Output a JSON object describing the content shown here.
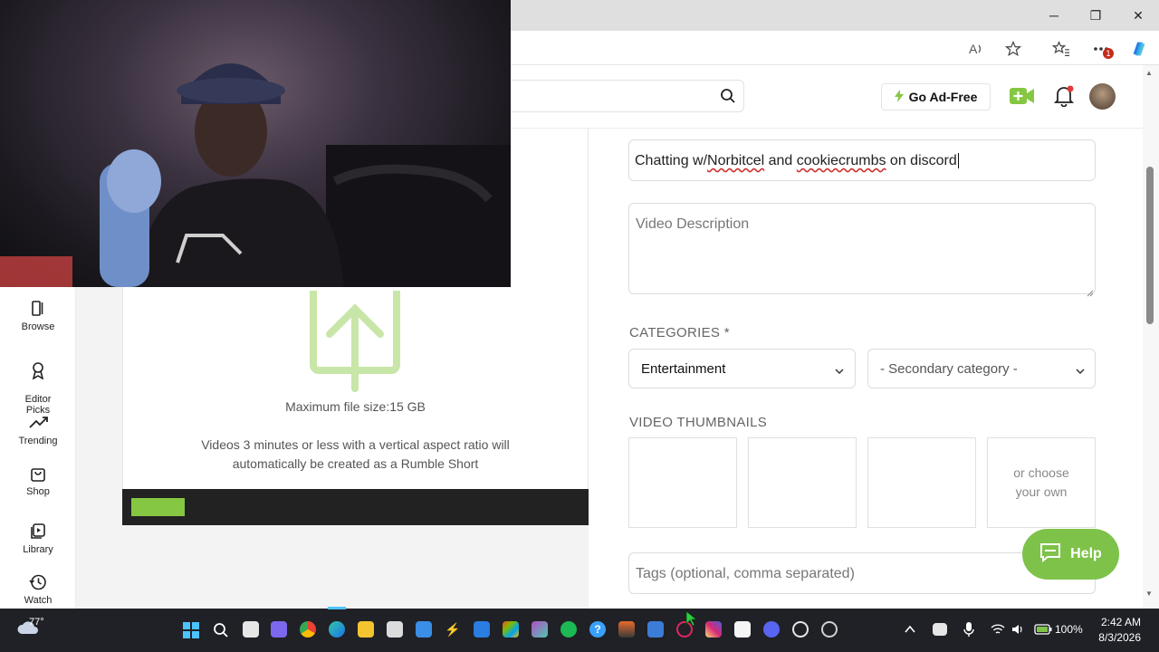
{
  "browser": {
    "window_controls": [
      "─",
      "❐",
      "✕"
    ],
    "notification_count": "1"
  },
  "header": {
    "go_adfree_label": "Go Ad-Free"
  },
  "sidebar": {
    "items": [
      {
        "label": "Browse"
      },
      {
        "label": "Editor\nPicks"
      },
      {
        "label": "Trending"
      },
      {
        "label": "Shop"
      },
      {
        "label": "Library"
      },
      {
        "label": "Watch"
      }
    ]
  },
  "upload": {
    "max_size": "Maximum file size:15 GB",
    "note": "Videos 3 minutes or less with a vertical aspect ratio will automatically be created as a Rumble Short",
    "progress": 0.12
  },
  "form": {
    "title_prefix": "Chatting w/",
    "title_word1": "Norbitcel",
    "title_mid": " and ",
    "title_word2": "cookiecrumbs",
    "title_suffix": " on discord",
    "description_placeholder": "Video Description",
    "categories_label": "CATEGORIES *",
    "category_selected": "Entertainment",
    "secondary_category": "- Secondary category -",
    "thumbnails_label": "VIDEO THUMBNAILS",
    "choose_own": "or choose your own",
    "tags_placeholder": "Tags (optional, comma separated)"
  },
  "help": {
    "label": "Help"
  },
  "taskbar": {
    "weather": "77°",
    "battery": "100%",
    "time": "2:42 AM",
    "date": "8/3/2026"
  },
  "colors": {
    "accent_green": "#85c742",
    "help_green": "#7ec24a",
    "upload_icon": "#c8e6a8"
  }
}
